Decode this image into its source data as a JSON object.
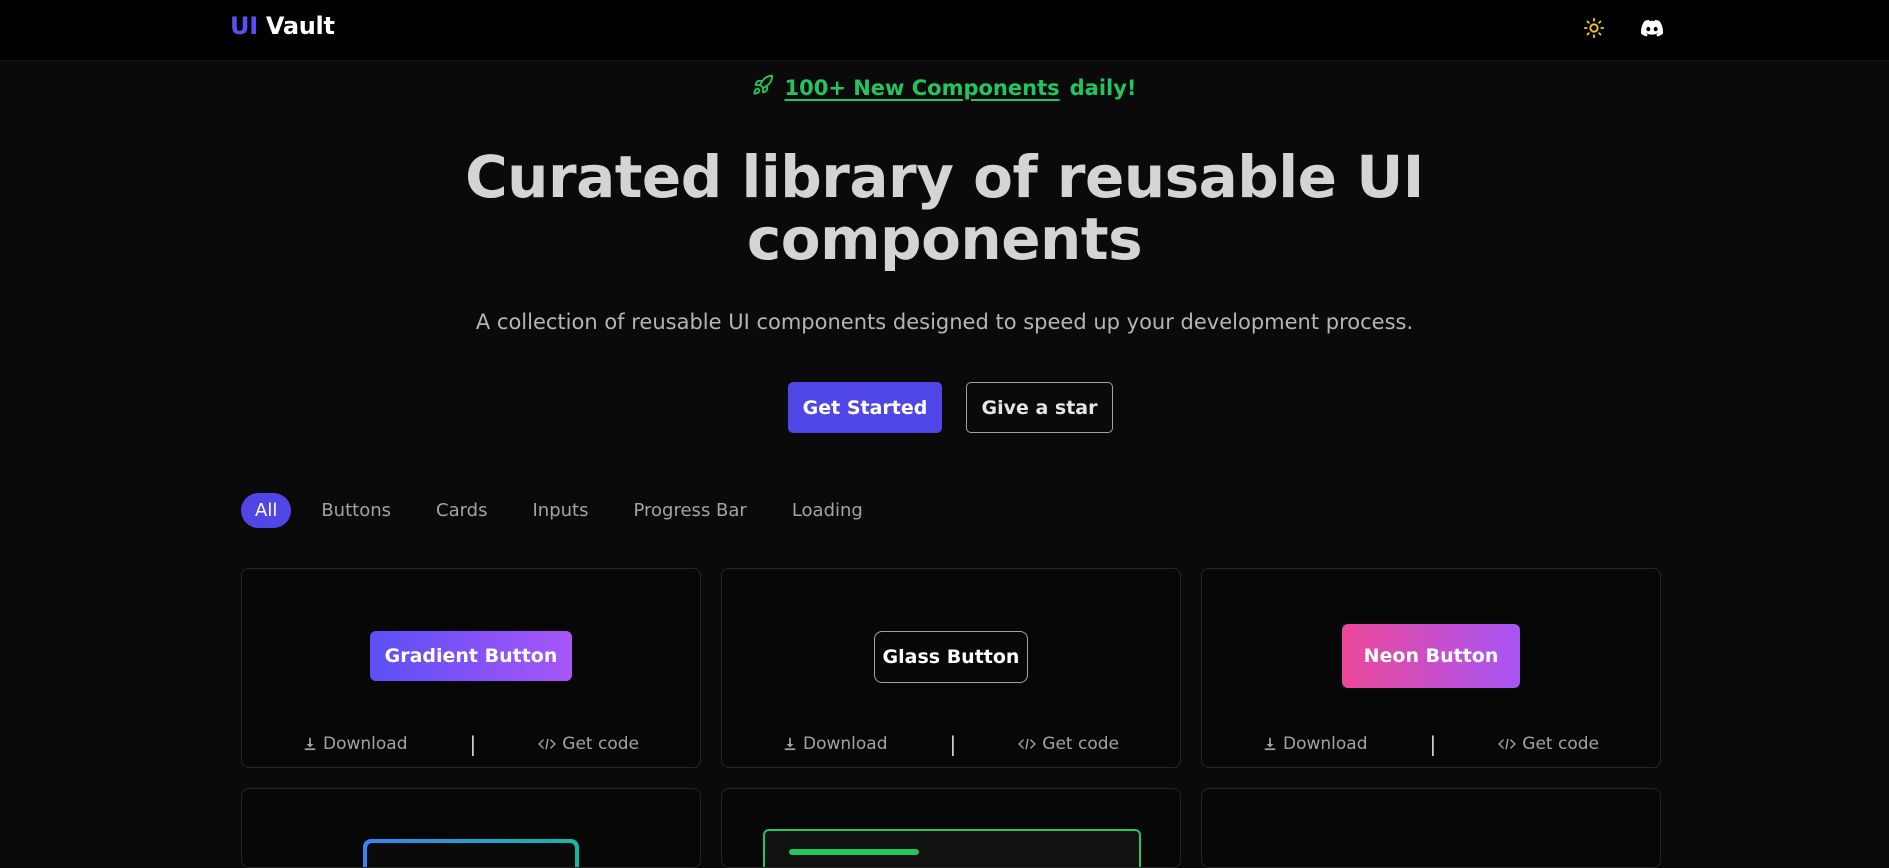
{
  "header": {
    "logo_part1": "UI",
    "logo_part2": "Vault",
    "theme_icon": "sun-icon",
    "discord_icon": "discord-icon"
  },
  "banner": {
    "icon": "rocket-icon",
    "link_text": "100+ New Components",
    "suffix": "daily!",
    "color": "#22c55e"
  },
  "hero": {
    "title_line1": "Curated library of reusable UI",
    "title_line2": "components",
    "subtitle": "A collection of reusable UI components designed to speed up your development process.",
    "primary_cta": "Get Started",
    "secondary_cta": "Give a star"
  },
  "filters": [
    "All",
    "Buttons",
    "Cards",
    "Inputs",
    "Progress Bar",
    "Loading"
  ],
  "active_filter": "All",
  "accent_color": "#4f46e5",
  "cards": [
    {
      "demo_label": "Gradient Button",
      "download_label": "Download",
      "code_label": "Get code"
    },
    {
      "demo_label": "Glass Button",
      "download_label": "Download",
      "code_label": "Get code"
    },
    {
      "demo_label": "Neon Button",
      "download_label": "Download",
      "code_label": "Get code"
    }
  ],
  "separator": "|"
}
